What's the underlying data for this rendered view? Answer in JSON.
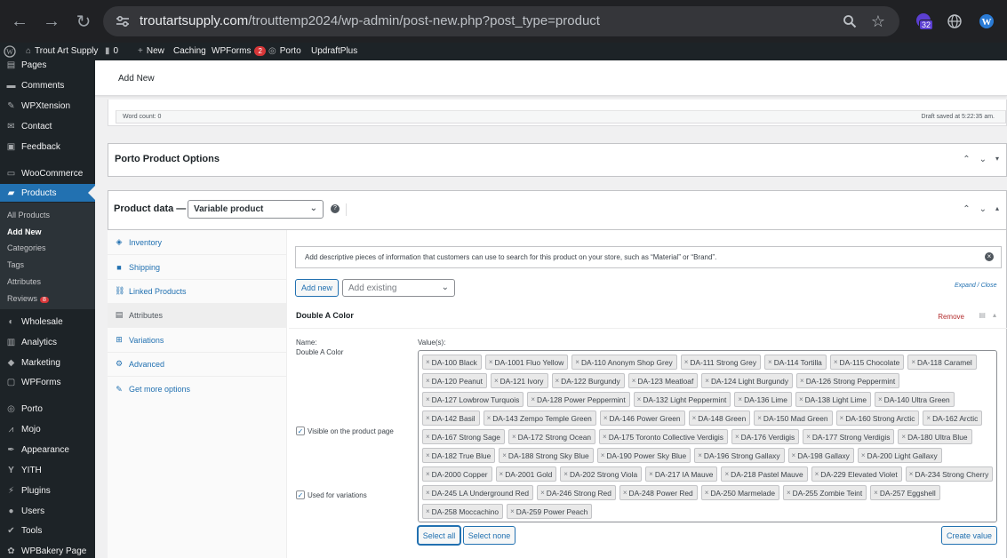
{
  "browser": {
    "url_domain": "troutartsupply.com",
    "url_path": "/trouttemp2024/wp-admin/post-new.php?post_type=product",
    "ext_badge": "32"
  },
  "admin_bar": {
    "site_name": "Trout Art Supply",
    "comments_count": "0",
    "new_label": "New",
    "caching_label": "Caching",
    "wpforms_label": "WPForms",
    "wpforms_badge": "2",
    "porto_label": "Porto",
    "updraft_label": "UpdraftPlus"
  },
  "sidebar": {
    "items": [
      {
        "label": "Pages",
        "icon": "pages-icon"
      },
      {
        "label": "Comments",
        "icon": "comments-icon"
      },
      {
        "label": "WPXtension",
        "icon": "wpxtension-icon"
      },
      {
        "label": "Contact",
        "icon": "contact-icon"
      },
      {
        "label": "Feedback",
        "icon": "feedback-icon"
      },
      {
        "label": "WooCommerce",
        "icon": "woocommerce-icon"
      },
      {
        "label": "Products",
        "icon": "products-icon"
      },
      {
        "label": "Wholesale",
        "icon": "wholesale-icon"
      },
      {
        "label": "Analytics",
        "icon": "analytics-icon"
      },
      {
        "label": "Marketing",
        "icon": "marketing-icon"
      },
      {
        "label": "WPForms",
        "icon": "wpforms-icon"
      },
      {
        "label": "Porto",
        "icon": "porto-icon"
      },
      {
        "label": "Mojo",
        "icon": "mojo-icon"
      },
      {
        "label": "Appearance",
        "icon": "appearance-icon"
      },
      {
        "label": "YITH",
        "icon": "yith-icon"
      },
      {
        "label": "Plugins",
        "icon": "plugins-icon"
      },
      {
        "label": "Users",
        "icon": "users-icon"
      },
      {
        "label": "Tools",
        "icon": "tools-icon"
      },
      {
        "label": "WPBakery Page",
        "icon": "wpbakery-icon"
      }
    ],
    "submenu": [
      "All Products",
      "Add New",
      "Categories",
      "Tags",
      "Attributes",
      "Reviews"
    ],
    "reviews_badge": "8"
  },
  "header": {
    "title": "Add New"
  },
  "editor": {
    "word_count": "Word count: 0",
    "draft_saved": "Draft saved at 5:22:35 am."
  },
  "porto_box": {
    "title": "Porto Product Options"
  },
  "product_data": {
    "title": "Product data —",
    "type_selected": "Variable product",
    "tabs": [
      "Inventory",
      "Shipping",
      "Linked Products",
      "Attributes",
      "Variations",
      "Advanced",
      "Get more options"
    ],
    "notice": "Add descriptive pieces of information that customers can use to search for this product on your store, such as “Material” or “Brand”.",
    "add_new": "Add new",
    "add_existing_placeholder": "Add existing",
    "expand_close": "Expand / Close"
  },
  "attribute": {
    "title": "Double A Color",
    "remove": "Remove",
    "name_label": "Name:",
    "name_value": "Double A Color",
    "values_label": "Value(s):",
    "visible_label": "Visible on the product page",
    "variations_label": "Used for variations",
    "select_all": "Select all",
    "select_none": "Select none",
    "create_value": "Create value",
    "values": [
      "DA-100 Black",
      "DA-1001 Fluo Yellow",
      "DA-110 Anonym Shop Grey",
      "DA-111 Strong Grey",
      "DA-114 Tortilla",
      "DA-115 Chocolate",
      "DA-118 Caramel",
      "DA-120 Peanut",
      "DA-121 Ivory",
      "DA-122 Burgundy",
      "DA-123 Meatloaf",
      "DA-124 Light Burgundy",
      "DA-126 Strong Peppermint",
      "DA-127 Lowbrow Turquois",
      "DA-128 Power Peppermint",
      "DA-132 Light Peppermint",
      "DA-136 Lime",
      "DA-138 Light Lime",
      "DA-140 Ultra Green",
      "DA-142 Basil",
      "DA-143 Zempo Temple Green",
      "DA-146 Power Green",
      "DA-148 Green",
      "DA-150 Mad Green",
      "DA-160 Strong Arctic",
      "DA-162 Arctic",
      "DA-167 Strong Sage",
      "DA-172 Strong Ocean",
      "DA-175 Toronto Collective Verdigis",
      "DA-176 Verdigis",
      "DA-177 Strong Verdigis",
      "DA-180 Ultra Blue",
      "DA-182 True Blue",
      "DA-188 Strong Sky Blue",
      "DA-190 Power Sky Blue",
      "DA-196 Strong Gallaxy",
      "DA-198 Gallaxy",
      "DA-200 Light Gallaxy",
      "DA-2000 Copper",
      "DA-2001 Gold",
      "DA-202 Strong Viola",
      "DA-217 IA Mauve",
      "DA-218 Pastel Mauve",
      "DA-229 Elevated Violet",
      "DA-234 Strong Cherry",
      "DA-245 LA Underground Red",
      "DA-246 Strong Red",
      "DA-248 Power Red",
      "DA-250 Marmelade",
      "DA-255 Zombie Teint",
      "DA-257 Eggshell",
      "DA-258 Moccachino",
      "DA-259 Power Peach"
    ]
  }
}
